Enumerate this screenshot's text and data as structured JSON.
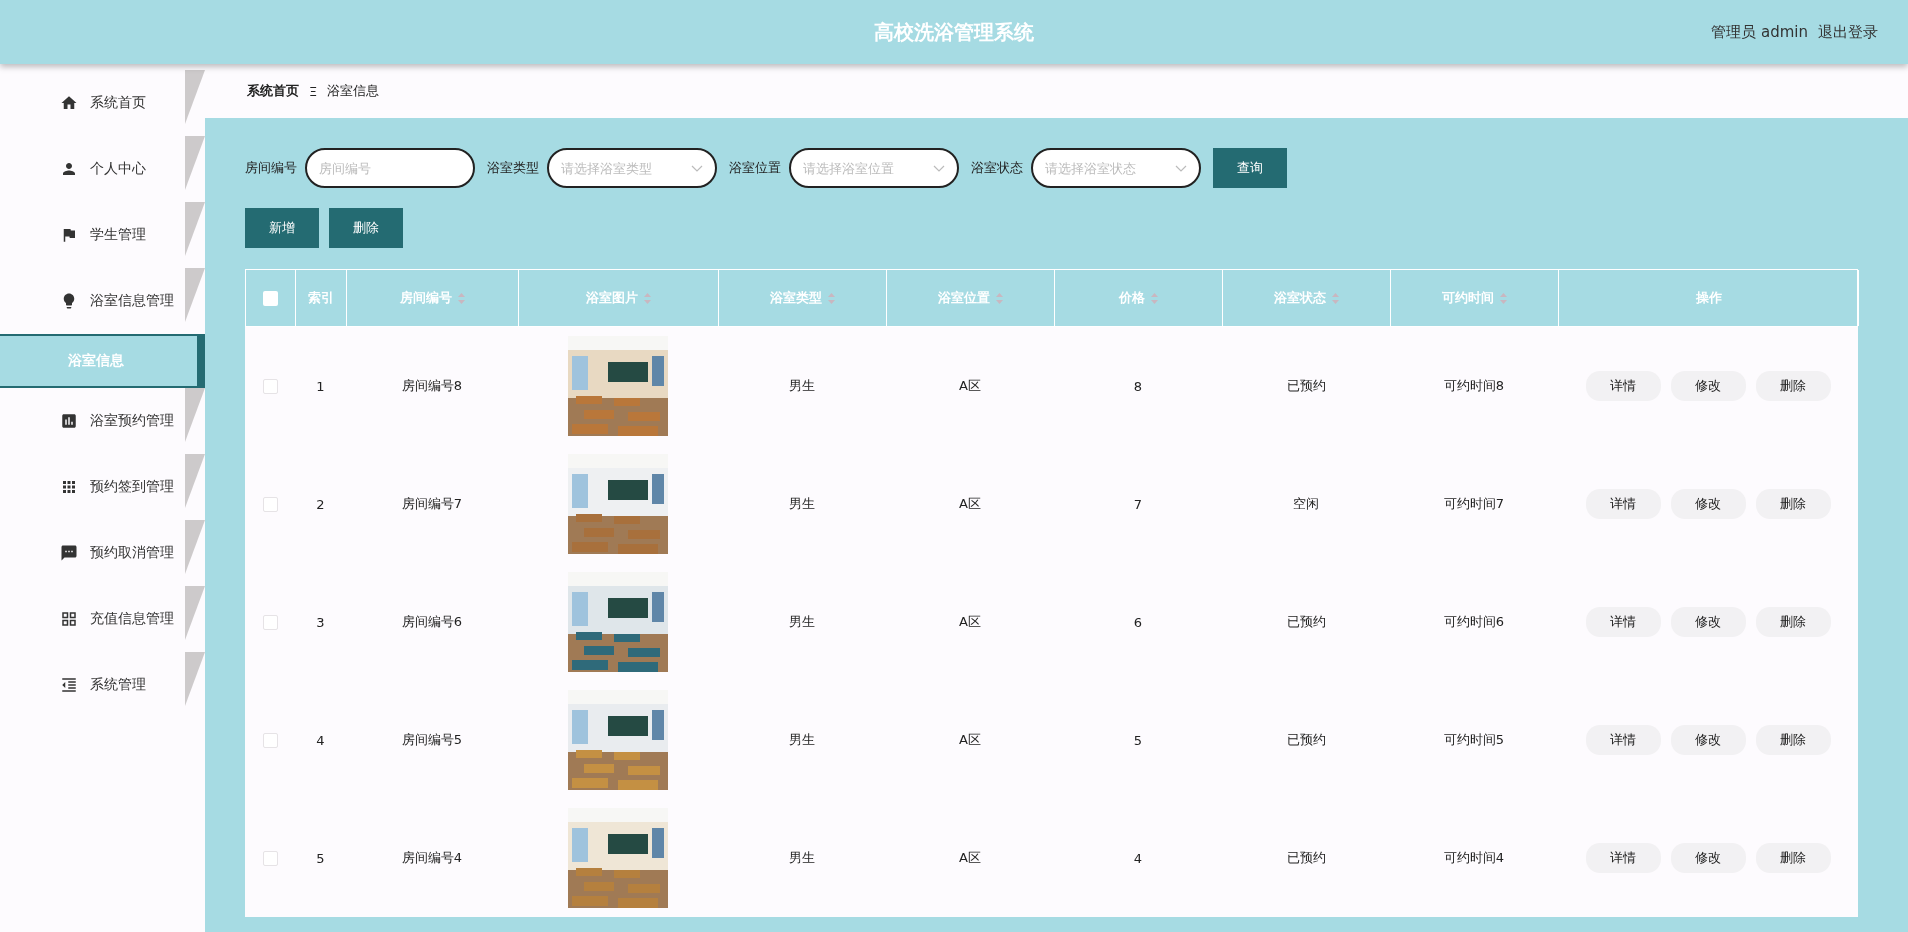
{
  "header": {
    "title": "高校洗浴管理系统",
    "user": "管理员 admin",
    "logout": "退出登录"
  },
  "sidebar": {
    "items": [
      {
        "label": "系统首页",
        "selected": false
      },
      {
        "label": "个人中心",
        "selected": false
      },
      {
        "label": "学生管理",
        "selected": false
      },
      {
        "label": "浴室信息管理",
        "selected": false,
        "children": [
          {
            "label": "浴室信息",
            "selected": true
          }
        ]
      },
      {
        "label": "浴室预约管理",
        "selected": false
      },
      {
        "label": "预约签到管理",
        "selected": false
      },
      {
        "label": "预约取消管理",
        "selected": false
      },
      {
        "label": "充值信息管理",
        "selected": false
      },
      {
        "label": "系统管理",
        "selected": false
      }
    ]
  },
  "breadcrumb": {
    "home": "系统首页",
    "separator": "Ξ",
    "current": "浴室信息"
  },
  "filters": [
    {
      "label": "房间编号",
      "placeholder": "房间编号",
      "kind": "text"
    },
    {
      "label": "浴室类型",
      "placeholder": "请选择浴室类型",
      "kind": "select"
    },
    {
      "label": "浴室位置",
      "placeholder": "请选择浴室位置",
      "kind": "select"
    },
    {
      "label": "浴室状态",
      "placeholder": "请选择浴室状态",
      "kind": "select"
    }
  ],
  "search_button": "查询",
  "actions": [
    "新增",
    "删除"
  ],
  "table": {
    "select_all": {
      "checked": false
    },
    "columns": [
      {
        "label": "索引",
        "sortable": false
      },
      {
        "label": "房间编号",
        "sortable": true
      },
      {
        "label": "浴室图片",
        "sortable": true
      },
      {
        "label": "浴室类型",
        "sortable": true
      },
      {
        "label": "浴室位置",
        "sortable": true
      },
      {
        "label": "价格",
        "sortable": true
      },
      {
        "label": "浴室状态",
        "sortable": true
      },
      {
        "label": "可约时间",
        "sortable": true
      },
      {
        "label": "操作",
        "sortable": false
      }
    ],
    "rows": [
      {
        "checked": false,
        "index": "1",
        "room": "房间编号8",
        "picture": {
          "kind": "picture"
        },
        "type": "男生",
        "location": "A区",
        "price": "8",
        "status": "已预约",
        "time": "可约时间8",
        "buttons": [
          "详情",
          "修改",
          "删除"
        ]
      },
      {
        "checked": false,
        "index": "2",
        "room": "房间编号7",
        "picture": {
          "kind": "picture"
        },
        "type": "男生",
        "location": "A区",
        "price": "7",
        "status": "空闲",
        "time": "可约时间7",
        "buttons": [
          "详情",
          "修改",
          "删除"
        ]
      },
      {
        "checked": false,
        "index": "3",
        "room": "房间编号6",
        "picture": {
          "kind": "picture"
        },
        "type": "男生",
        "location": "A区",
        "price": "6",
        "status": "已预约",
        "time": "可约时间6",
        "buttons": [
          "详情",
          "修改",
          "删除"
        ]
      },
      {
        "checked": false,
        "index": "4",
        "room": "房间编号5",
        "picture": {
          "kind": "picture"
        },
        "type": "男生",
        "location": "A区",
        "price": "5",
        "status": "已预约",
        "time": "可约时间5",
        "buttons": [
          "详情",
          "修改",
          "删除"
        ]
      },
      {
        "checked": false,
        "index": "5",
        "room": "房间编号4",
        "picture": {
          "kind": "picture"
        },
        "type": "男生",
        "location": "A区",
        "price": "4",
        "status": "已预约",
        "time": "可约时间4",
        "buttons": [
          "详情",
          "修改",
          "删除"
        ]
      }
    ]
  }
}
